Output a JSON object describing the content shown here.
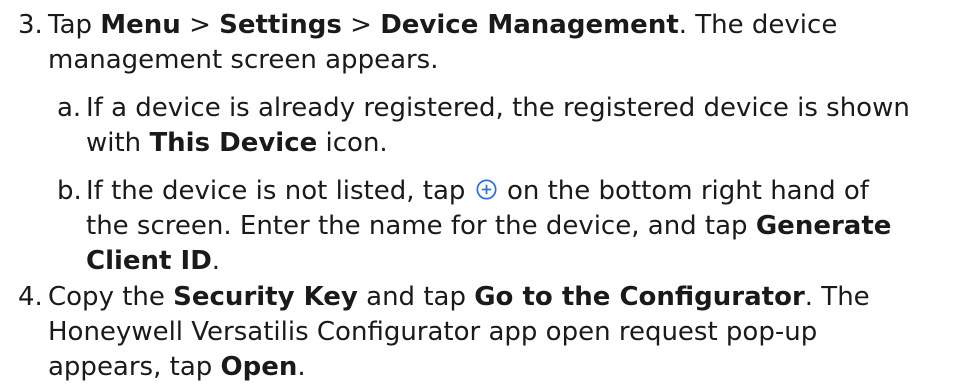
{
  "steps": [
    {
      "number": "3.",
      "lines": [
        [
          "Tap ",
          "Menu",
          " > ",
          "Settings",
          " > ",
          "Device Management",
          ". The device"
        ],
        [
          "management screen appears."
        ]
      ]
    },
    {
      "number": "4.",
      "lines": [
        [
          "Copy the ",
          "Security Key",
          " and tap ",
          "Go to the Configurator",
          ". The"
        ],
        [
          "Honeywell Versatilis Configurator app open request pop-up"
        ],
        [
          "appears, tap ",
          "Open",
          "."
        ]
      ]
    }
  ],
  "substeps": [
    {
      "letter": "a.",
      "lines": [
        [
          "If a device is already registered, the registered device is shown"
        ],
        [
          "with ",
          "This Device",
          " icon."
        ]
      ]
    },
    {
      "letter": "b.",
      "lines": [
        [
          "If the device is not listed, tap ",
          " on the bottom right hand of"
        ],
        [
          "the screen. Enter the name for the device, and tap ",
          "Generate"
        ],
        [
          "Client ID",
          "."
        ]
      ]
    }
  ],
  "icons": {
    "add": "plus-circle-icon",
    "add_color": "#2e6fd6"
  }
}
